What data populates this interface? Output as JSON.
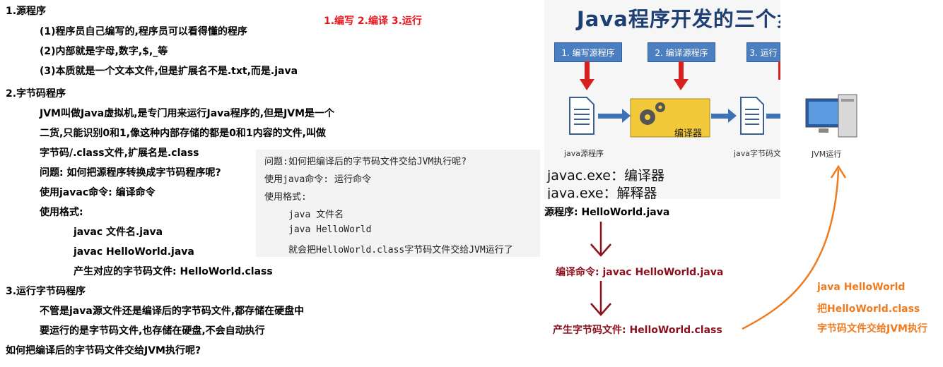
{
  "left_notes": {
    "h1": "1.源程序",
    "l1": "(1)程序员自己编写的,程序员可以看得懂的程序",
    "l2": "(2)内部就是字母,数字,$,_等",
    "l3": "(3)本质就是一个文本文件,但是扩展名不是.txt,而是.java",
    "h2": "2.字节码程序",
    "l4": "JVM叫做Java虚拟机,是专门用来运行Java程序的,但是JVM是一个",
    "l5": "二货,只能识别0和1,像这种内部存储的都是0和1内容的文件,叫做",
    "l6": "字节码/.class文件,扩展名是.class",
    "l7": "问题: 如何把源程序转换成字节码程序呢?",
    "l8": "使用javac命令: 编译命令",
    "l9": "使用格式:",
    "l10": "javac 文件名.java",
    "l11": "javac HelloWorld.java",
    "l12": "产生对应的字节码文件: HelloWorld.class",
    "h3": "3.运行字节码程序",
    "l13": "不管是java源文件还是编译后的字节码文件,都存储在硬盘中",
    "l14": "要运行的是字节码文件,也存储在硬盘,不会自动执行",
    "l15": "如何把编译后的字节码文件交给JVM执行呢?"
  },
  "steps_header": "1.编写 2.编译 3.运行",
  "mono_box": {
    "m1": "问题:如何把编译后的字节码文件交给JVM执行呢?",
    "m2": "使用java命令: 运行命令",
    "m3": "使用格式:",
    "m4": "java 文件名",
    "m5": "java HelloWorld",
    "m6": "就会把HelloWorld.class字节码文件交给JVM运行了"
  },
  "diagram": {
    "title": "Java程序开发的三个步骤",
    "step1": "1. 编写源程序",
    "step2": "2. 编译源程序",
    "step3": "3. 运行",
    "compiler": "编译器",
    "src_label": "java源程序",
    "bytecode_label": "java字节码文件",
    "jvm_label": "JVM运行",
    "cmd1": "javac.exe：编译器",
    "cmd2": "java.exe：解释器"
  },
  "flow": {
    "source": "源程序: HelloWorld.java",
    "compile": "编译命令: javac HelloWorld.java",
    "output": "产生字节码文件: HelloWorld.class",
    "run1": "java HelloWorld",
    "run2": "把HelloWorld.class",
    "run3": "字节码文件交给JVM执行"
  },
  "colors": {
    "step_red": "#e8141c",
    "flow_dark_red": "#8b0f1c",
    "run_orange": "#f07b1f",
    "diagram_blue": "#4b7fc0"
  }
}
